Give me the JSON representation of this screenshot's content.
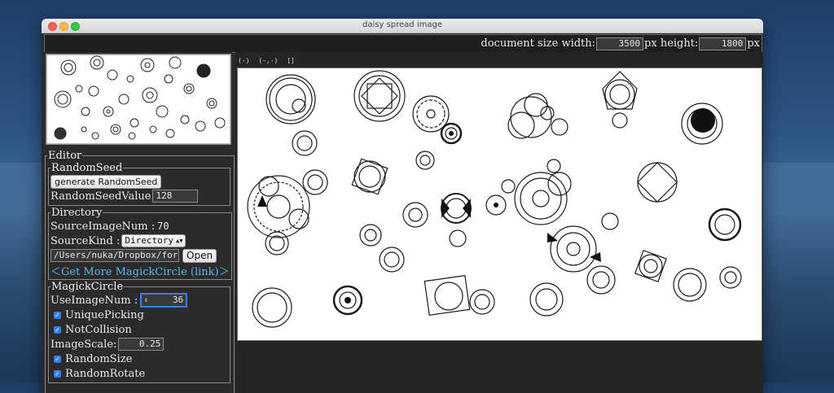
{
  "window": {
    "title": "daisy spread image"
  },
  "topbar": {
    "width_label": "document size width:",
    "width_value": "3500",
    "height_label": "px height:",
    "height_value": "1800",
    "unit_label": "px"
  },
  "canvas_controls": [
    "(-)",
    "(-,-)",
    "[]"
  ],
  "editor": {
    "legend": "Editor",
    "random_seed": {
      "legend": "RandomSeed",
      "generate_label": "generate RandomSeed",
      "value_label": "RandomSeedValue",
      "value": "128"
    },
    "directory": {
      "legend": "Directory",
      "source_num_label": "SourceImageNum : ",
      "source_num": "70",
      "source_kind_label": "SourceKind : ",
      "source_kind_value": "Directory",
      "path_value": "/Users/nuka/Dropbox/for",
      "open_label": "Open",
      "link_label": "＜Get More MagickCircle (link)＞"
    },
    "magick_circle": {
      "legend": "MagickCircle",
      "use_num_label": "UseImageNum : ",
      "use_num_value": "36",
      "unique_picking_label": "UniquePicking",
      "not_collision_label": "NotCollision",
      "image_scale_label": "ImageScale:",
      "image_scale_value": "0.25",
      "random_size_label": "RandomSize",
      "random_rotate_label": "RandomRotate"
    }
  },
  "colors": {
    "accent": "#5ab4f0",
    "checkbox": "#2f7ff0",
    "panel": "#2b2b2b"
  },
  "icons": [
    "close-dot",
    "minimize-dot",
    "maximize-dot",
    "checkmark",
    "stepper-arrows"
  ]
}
